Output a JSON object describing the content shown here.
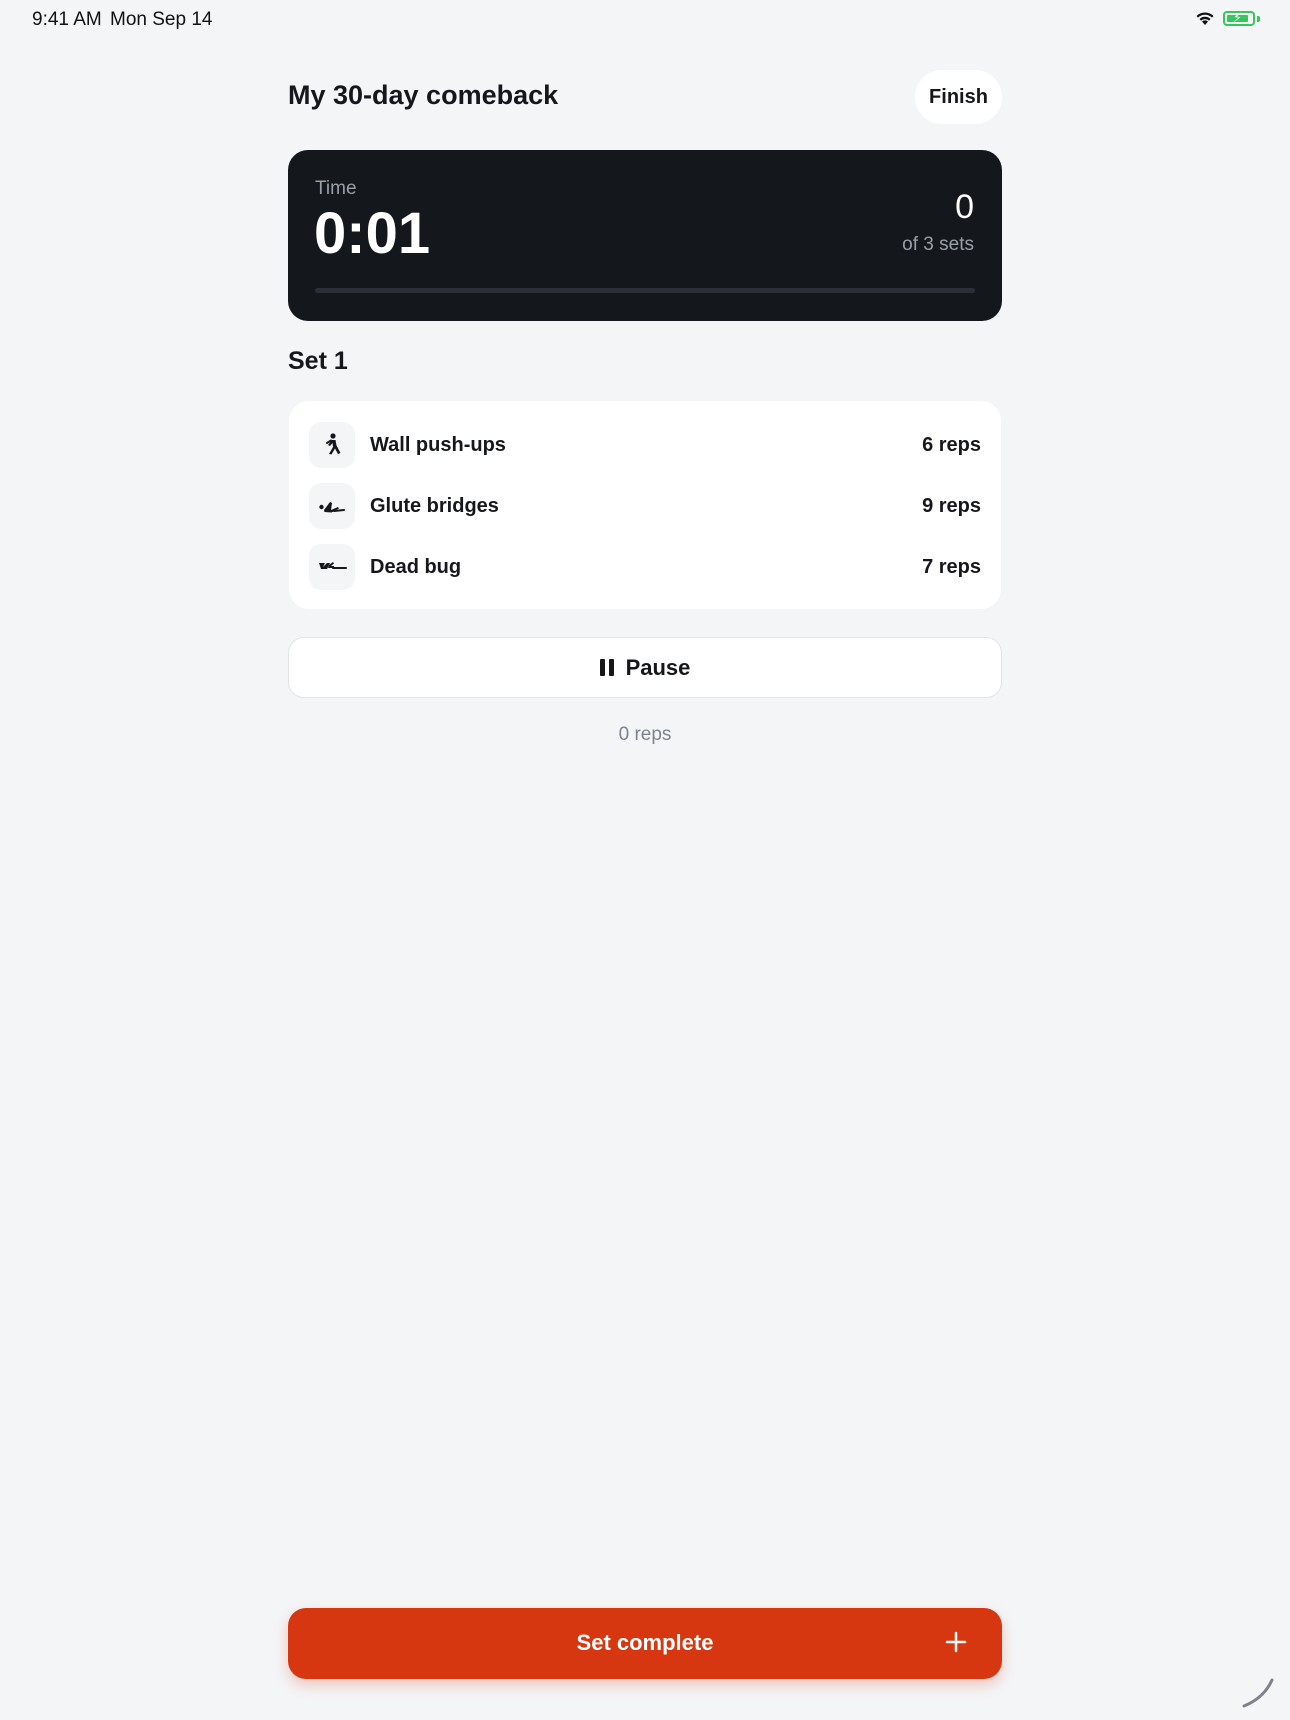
{
  "status_bar": {
    "time": "9:41 AM",
    "date": "Mon Sep 14",
    "battery_level": 0.9,
    "battery_color": "#34c759"
  },
  "header": {
    "title": "My 30-day comeback",
    "finish_label": "Finish"
  },
  "timer": {
    "label": "Time",
    "value": "0:01",
    "sets_completed": "0",
    "sets_caption": "of 3 sets",
    "progress": 0
  },
  "set": {
    "heading": "Set 1",
    "exercises": [
      {
        "name": "Wall push-ups",
        "reps": "6 reps",
        "icon": "push-up-icon"
      },
      {
        "name": "Glute bridges",
        "reps": "9 reps",
        "icon": "glute-bridge-icon"
      },
      {
        "name": "Dead bug",
        "reps": "7 reps",
        "icon": "dead-bug-icon"
      }
    ]
  },
  "controls": {
    "pause_label": "Pause",
    "reps_total": "0 reps",
    "set_complete_label": "Set complete"
  },
  "colors": {
    "accent": "#d63710",
    "card_dark": "#14171c",
    "background": "#f4f5f7"
  }
}
